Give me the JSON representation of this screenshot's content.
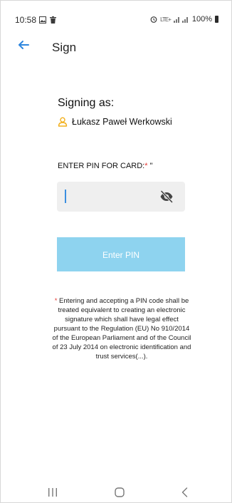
{
  "status_bar": {
    "time": "10:58",
    "network_glyph": "LTE+",
    "battery_percent": "100%",
    "left_icons": [
      "gallery-icon",
      "trash-icon"
    ],
    "right_icons": [
      "alarm-icon",
      "signal-icon",
      "battery-icon"
    ]
  },
  "app_bar": {
    "title": "Sign",
    "back_icon": "arrow-left-icon",
    "accent_color": "#2e86de"
  },
  "signing": {
    "heading": "Signing as:",
    "signer_name": "Łukasz Paweł Werkowski",
    "signer_icon": "user-icon",
    "signer_icon_color": "#f2b01e"
  },
  "pin": {
    "label": "ENTER PIN FOR CARD:",
    "required_mark": "*",
    "label_suffix": " \"",
    "value": "",
    "placeholder": "",
    "visibility_icon": "eye-off-icon"
  },
  "button": {
    "label": "Enter PIN",
    "color": "#8ed3ef"
  },
  "disclaimer": {
    "mark": "*",
    "text": " Entering and accepting a PIN code shall be treated equivalent to creating an electronic signature which shall have legal effect pursuant to the Regulation (EU) No 910/2014 of the European Parliament and of the Council of 23 July 2014 on electronic identification and trust services(...)."
  },
  "nav_bar": {
    "buttons": [
      "recent-apps-icon",
      "home-icon",
      "back-icon"
    ]
  }
}
